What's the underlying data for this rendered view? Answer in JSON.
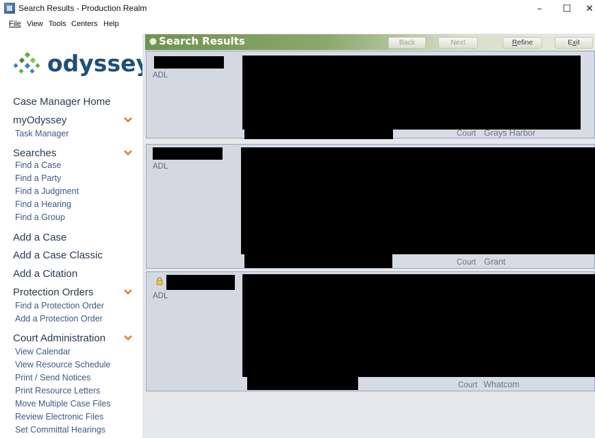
{
  "window": {
    "title": "Search Results - Production Realm",
    "controls": {
      "minimize": "–",
      "maximize": "☐",
      "close": "✕"
    }
  },
  "menu": [
    {
      "label": "File",
      "underline": "F",
      "rest": "ile"
    },
    {
      "label": "View",
      "underline": "",
      "rest": "View"
    },
    {
      "label": "Tools",
      "underline": "T",
      "rest": "ools"
    },
    {
      "label": "Centers",
      "underline": "",
      "rest": "Centers"
    },
    {
      "label": "Help",
      "underline": "H",
      "rest": "elp"
    }
  ],
  "logo": {
    "text": "odyssey"
  },
  "sidebar": {
    "case_manager_home": "Case Manager Home",
    "my_odyssey": "myOdyssey",
    "task_manager": "Task Manager",
    "searches": "Searches",
    "search_items": [
      "Find a Case",
      "Find a Party",
      "Find a Judgment",
      "Find a Hearing",
      "Find a Group"
    ],
    "add_case": "Add a Case",
    "add_case_classic": "Add a Case Classic",
    "add_citation": "Add a Citation",
    "protection_orders": "Protection Orders",
    "protection_items": [
      "Find a Protection Order",
      "Add a Protection Order"
    ],
    "court_admin": "Court Administration",
    "court_admin_items": [
      "View Calendar",
      "View Resource Schedule",
      "Print / Send Notices",
      "Print Resource Letters",
      "Move Multiple Case Files",
      "Review Electronic Files",
      "Set Committal Hearings"
    ]
  },
  "results": {
    "title": "Search Results",
    "buttons": {
      "back": "Back",
      "next": "Next",
      "refine_u": "R",
      "refine_rest": "efine",
      "exit_pre": "E",
      "exit_u": "x",
      "exit_rest": "it"
    },
    "cards": [
      {
        "tag": "ADL",
        "court_label": "Court",
        "court": "Grays Harbor"
      },
      {
        "tag": "ADL",
        "court_label": "Court",
        "court": "Grant"
      },
      {
        "tag": "ADL",
        "court_label": "Court",
        "court": "Whatcom",
        "locked": true
      }
    ]
  },
  "colors": {
    "header_green": "#6f9350",
    "nav_blue": "#3b5a86",
    "chevron_orange": "#e8742a",
    "logo_blue": "#1f4f7a"
  }
}
